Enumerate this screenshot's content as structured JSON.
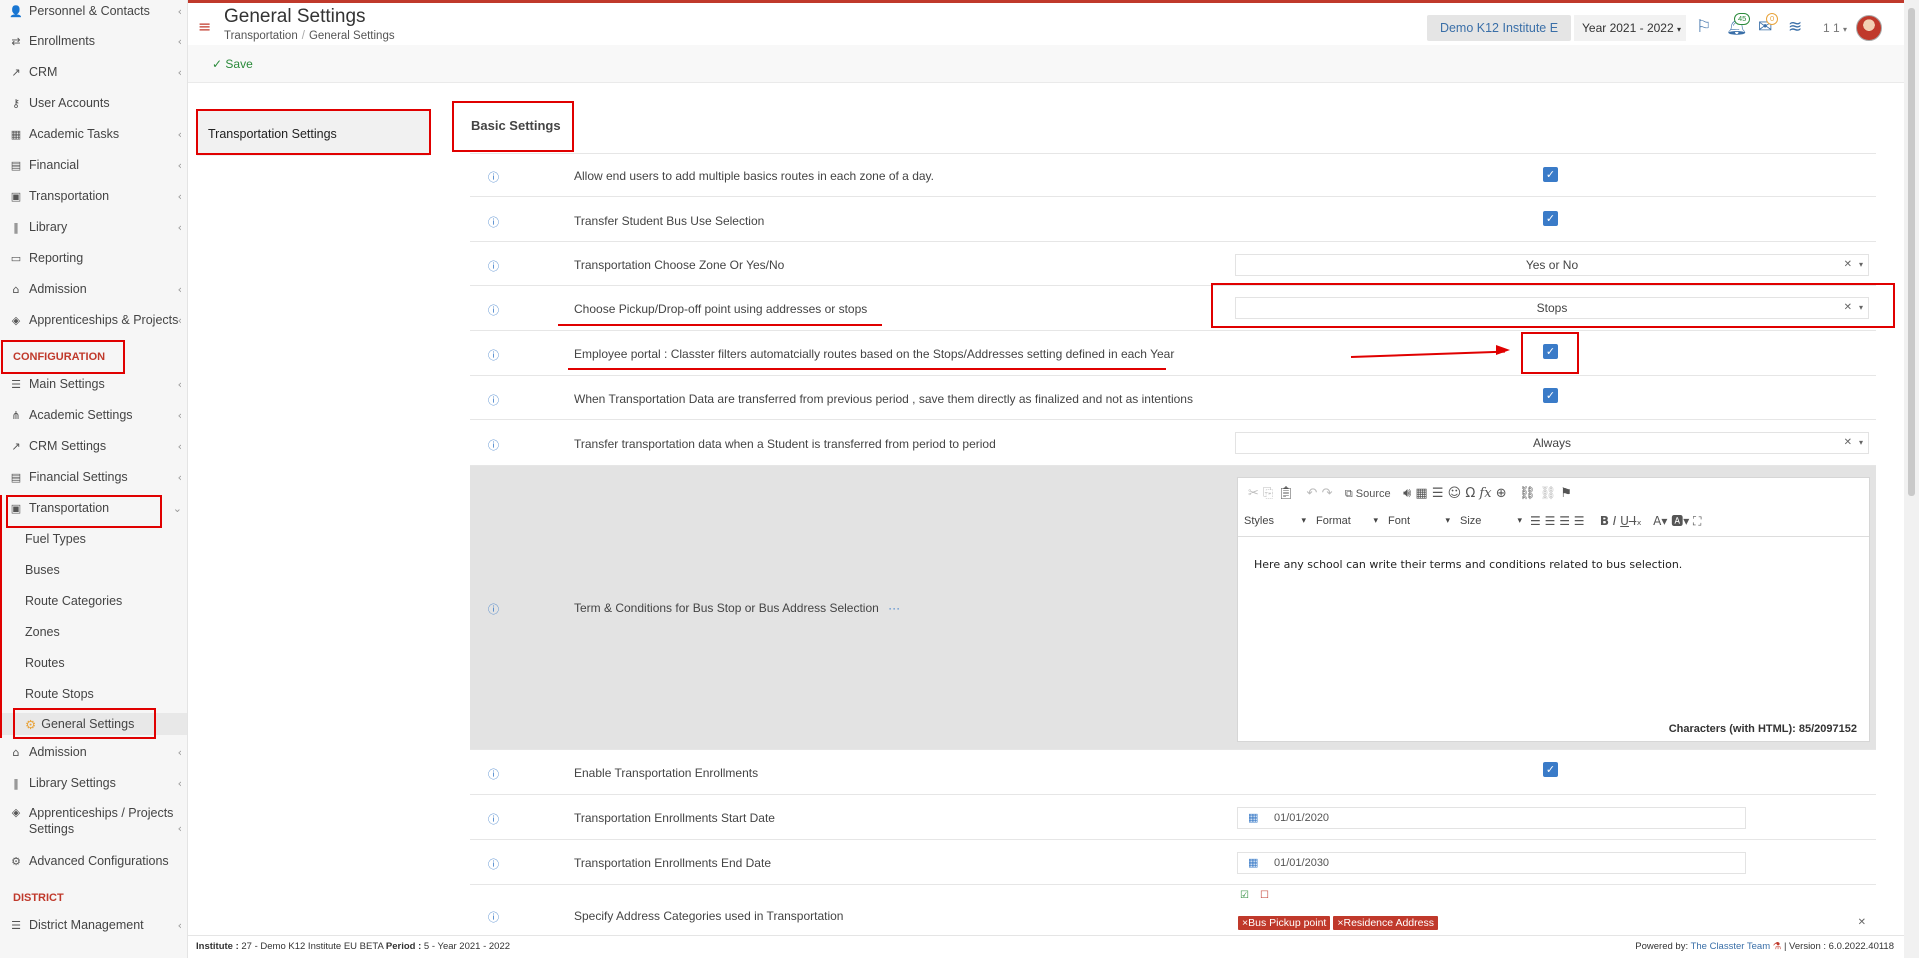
{
  "sidebar": {
    "items": [
      {
        "label": "Personnel & Contacts",
        "icon": "user-icon"
      },
      {
        "label": "Enrollments",
        "icon": "exchange-icon"
      },
      {
        "label": "CRM",
        "icon": "chart-icon"
      },
      {
        "label": "User Accounts",
        "icon": "key-icon"
      },
      {
        "label": "Academic Tasks",
        "icon": "grid-icon"
      },
      {
        "label": "Financial",
        "icon": "coins-icon"
      },
      {
        "label": "Transportation",
        "icon": "bus-icon"
      },
      {
        "label": "Library",
        "icon": "library-icon"
      },
      {
        "label": "Reporting",
        "icon": "print-icon"
      },
      {
        "label": "Admission",
        "icon": "institution-icon"
      },
      {
        "label": "Apprenticeships & Projects",
        "icon": "cube-icon"
      }
    ],
    "config_heading": "CONFIGURATION",
    "config_items": [
      {
        "label": "Main Settings"
      },
      {
        "label": "Academic Settings"
      },
      {
        "label": "CRM Settings"
      },
      {
        "label": "Financial Settings"
      },
      {
        "label": "Transportation"
      }
    ],
    "transport_sub": [
      "Fuel Types",
      "Buses",
      "Route Categories",
      "Zones",
      "Routes",
      "Route Stops",
      "General Settings"
    ],
    "config_items_after": [
      {
        "label": "Admission"
      },
      {
        "label": "Library Settings"
      },
      {
        "label": "Apprenticeships / Projects Settings"
      },
      {
        "label": "Advanced Configurations"
      }
    ],
    "district_heading": "DISTRICT",
    "district_items": [
      {
        "label": "District Management"
      }
    ]
  },
  "header": {
    "title": "General Settings",
    "breadcrumb": [
      "Transportation",
      "General Settings"
    ],
    "institute": "Demo K12 Institute E",
    "year": "Year 2021 - 2022",
    "notifications_count": "45",
    "messages_count": "0",
    "period": "1 1"
  },
  "toolbar": {
    "save_label": "Save"
  },
  "settings_nav": {
    "label": "Transportation Settings"
  },
  "section_title": "Basic Settings",
  "rows": [
    {
      "label": "Allow end users to add multiple basics routes in each zone of a day.",
      "type": "checkbox",
      "checked": true
    },
    {
      "label": "Transfer Student Bus Use Selection",
      "type": "checkbox",
      "checked": true
    },
    {
      "label": "Transportation Choose Zone Or Yes/No",
      "type": "select",
      "value": "Yes or No"
    },
    {
      "label": "Choose Pickup/Drop-off point using addresses or stops",
      "type": "select",
      "value": "Stops"
    },
    {
      "label": "Employee portal : Classter filters automatcially routes based on the Stops/Addresses setting defined in each Year",
      "type": "checkbox",
      "checked": true
    },
    {
      "label": "When Transportation Data are transferred from previous period , save them directly as finalized and not as intentions",
      "type": "checkbox",
      "checked": true
    },
    {
      "label": "Transfer transportation data when a Student is transferred from period to period",
      "type": "select",
      "value": "Always"
    },
    {
      "label": "Term & Conditions for Bus Stop or Bus Address Selection",
      "type": "editor",
      "more": "···"
    },
    {
      "label": "Enable Transportation Enrollments",
      "type": "checkbox",
      "checked": true
    },
    {
      "label": "Transportation Enrollments Start Date",
      "type": "date",
      "value": "01/01/2020"
    },
    {
      "label": "Transportation Enrollments End Date",
      "type": "date",
      "value": "01/01/2030"
    },
    {
      "label": "Specify Address Categories used in Transportation",
      "type": "tags",
      "tags": [
        "Bus Pickup point",
        "Residence Address"
      ]
    }
  ],
  "editor": {
    "source_label": "Source",
    "combos": [
      "Styles",
      "Format",
      "Font",
      "Size"
    ],
    "content": "Here any school can write their terms and conditions related to bus selection.",
    "char_count": "Characters (with HTML): 85/2097152"
  },
  "footer": {
    "institute_label": "Institute :",
    "institute_value": "27 - Demo K12 Institute EU BETA",
    "period_label": "Period :",
    "period_value": "5 - Year 2021 - 2022",
    "powered_label": "Powered by:",
    "powered_team": "The Classter Team",
    "version": "| Version : 6.0.2022.40118"
  },
  "colors": {
    "accent": "#c0392b",
    "link": "#3a6fa8",
    "checkbox": "#3a7bc8",
    "annotation": "#e00000"
  }
}
